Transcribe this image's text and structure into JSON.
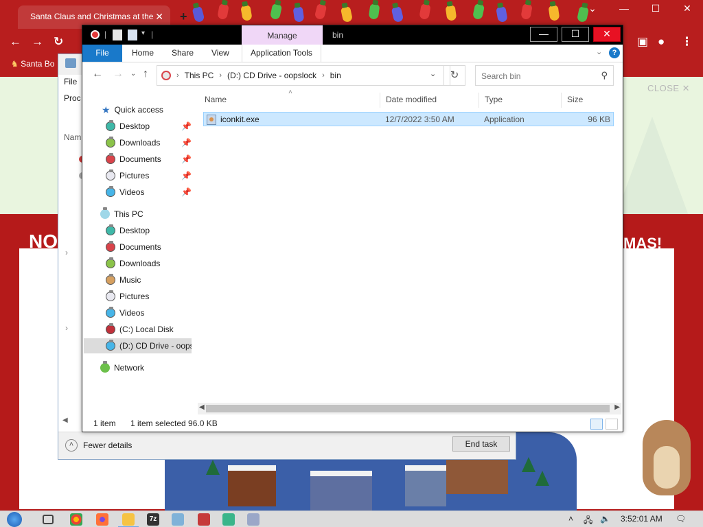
{
  "browser": {
    "tab_title": "Santa Claus and Christmas at the",
    "tab_close": "✕",
    "new_tab": "+",
    "bookmark": "Santa Bo",
    "close_ad": "CLOSE ✕",
    "banner_left": "NO",
    "banner_right": "MAS!"
  },
  "taskmgr": {
    "menu_file": "File",
    "processes_tab": "Proc",
    "name_col": "Nam",
    "fewer_details": "Fewer details",
    "end_task": "End task"
  },
  "explorer": {
    "title": "bin",
    "manage_tab": "Manage",
    "ribbon_tabs": [
      "File",
      "Home",
      "Share",
      "View",
      "Application Tools"
    ],
    "breadcrumbs": [
      "This PC",
      "(D:) CD Drive - oopslock",
      "bin"
    ],
    "search_placeholder": "Search bin",
    "nav_quick_access": "Quick access",
    "nav_qa_items": [
      {
        "label": "Desktop",
        "color": "#3fb8a8"
      },
      {
        "label": "Downloads",
        "color": "#8bc34a"
      },
      {
        "label": "Documents",
        "color": "#d9434a"
      },
      {
        "label": "Pictures",
        "color": "#e8e8f0"
      },
      {
        "label": "Videos",
        "color": "#47b5e8"
      }
    ],
    "nav_this_pc": "This PC",
    "nav_pc_items": [
      {
        "label": "Desktop",
        "color": "#3fb8a8"
      },
      {
        "label": "Documents",
        "color": "#d9434a"
      },
      {
        "label": "Downloads",
        "color": "#8bc34a"
      },
      {
        "label": "Music",
        "color": "#d6a060"
      },
      {
        "label": "Pictures",
        "color": "#e8e8f0"
      },
      {
        "label": "Videos",
        "color": "#47b5e8"
      },
      {
        "label": "(C:) Local Disk",
        "color": "#c0303a"
      },
      {
        "label": "(D:) CD Drive - oops",
        "color": "#47b5e8"
      }
    ],
    "nav_network": "Network",
    "columns": [
      "Name",
      "Date modified",
      "Type",
      "Size"
    ],
    "files": [
      {
        "name": "iconkit.exe",
        "date": "12/7/2022 3:50 AM",
        "type": "Application",
        "size": "96 KB"
      }
    ],
    "status_count": "1 item",
    "status_selected": "1 item selected  96.0 KB"
  },
  "taskbar": {
    "clock": "3:52:01 AM",
    "seven_zip": "7z"
  },
  "colors": {
    "accent": "#1979ca",
    "selection": "#cce8ff",
    "close_red": "#e81123",
    "manage_tab": "#f0d7f7"
  }
}
